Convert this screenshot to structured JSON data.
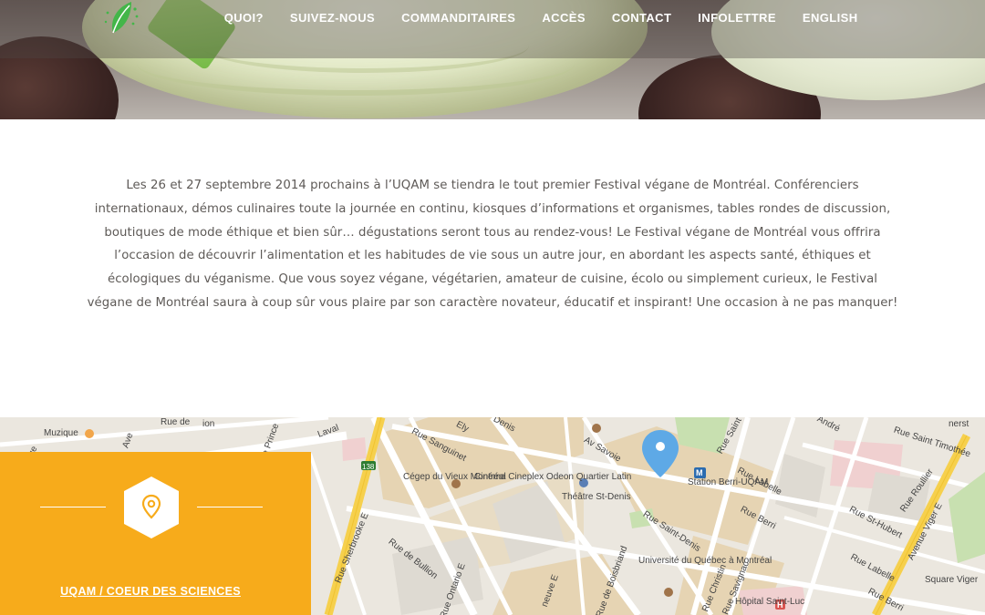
{
  "header": {
    "logo_icon": "leaf-logo-icon",
    "nav": [
      {
        "label": "QUOI?"
      },
      {
        "label": "SUIVEZ-NOUS"
      },
      {
        "label": "COMMANDITAIRES"
      },
      {
        "label": "ACCÈS"
      },
      {
        "label": "CONTACT"
      },
      {
        "label": "INFOLETTRE"
      },
      {
        "label": "ENGLISH"
      }
    ]
  },
  "intro": {
    "text": "Les 26 et 27 septembre 2014 prochains à l’UQAM se tiendra le tout premier Festival végane de Montréal. Conférenciers internationaux, démos culinaires toute la journée en continu, kiosques d’informations et organismes, tables rondes de discussion, boutiques de mode éthique et bien sûr… dégustations seront tous au rendez-vous! Le Festival végane de Montréal vous offrira l’occasion de découvrir l’alimentation et les habitudes de vie sous un autre jour, en abordant les aspects santé, éthiques et écologiques du véganisme. Que vous soyez végane, végétarien, amateur de cuisine, écolo ou simplement curieux, le Festival végane de Montréal saura à coup sûr vous plaire par son caractère novateur, éducatif et inspirant! Une occasion à ne pas manquer!"
  },
  "location_card": {
    "icon": "map-marker-icon",
    "place_label": "UQAM / COEUR DES SCIENCES",
    "accent_color": "#f7ab1b"
  },
  "map": {
    "pin_color": "#5ea9e6",
    "labels": {
      "muzique": "Muzique",
      "ave": "Ave",
      "laval": "Laval",
      "rue_sanguinet": "Rue Sanguinet",
      "rue_st_denis_top": "Denis",
      "av_savoie": "Av Savoie",
      "rue_saint_andre": "André",
      "rue_saint_timothee": "Rue Saint Timothée",
      "rue_labelle_1": "Rue Labelle",
      "rue_berri_1": "Rue Berri",
      "rue_saint_1": "Rue Saint",
      "cegep": "Cégep du Vieux Montréal",
      "cinema": "Cinéma Cineplex Odeon Quartier Latin",
      "theatre": "Théâtre St-Denis",
      "station": "Station Berri-UQAM",
      "rue_sherbrooke": "Rue Sherbrooke E",
      "rue_de_bullion": "Rue de Bullion",
      "rue_ontario": "Rue Ontario E",
      "rue_saint_denis": "Rue Saint-Denis",
      "universite": "Université du Québec à Montréal",
      "rue_christin": "Rue Christin",
      "rue_savignac": "Rue Savignac",
      "hopital": "Hôpital Saint-Luc",
      "rue_st_hubert": "Rue St-Hubert",
      "rue_roullier": "Rue Roullier",
      "square_viger": "Square Viger",
      "avenue_viger": "Avenue Viger E",
      "rue_labelle_2": "Rue Labelle",
      "rue_berri_2": "Rue Berri",
      "rue_de_boisbriand": "Rue de Boisbriand",
      "neuve": "neuve E",
      "route_138": "138",
      "metro_m": "M",
      "hospital_h": "H",
      "rue_prince": "Rue Prince",
      "ely": "Ely",
      "rue": "Rue",
      "rue_de": "Rue de",
      "nerst": "nerst",
      "ion": "ion"
    }
  }
}
